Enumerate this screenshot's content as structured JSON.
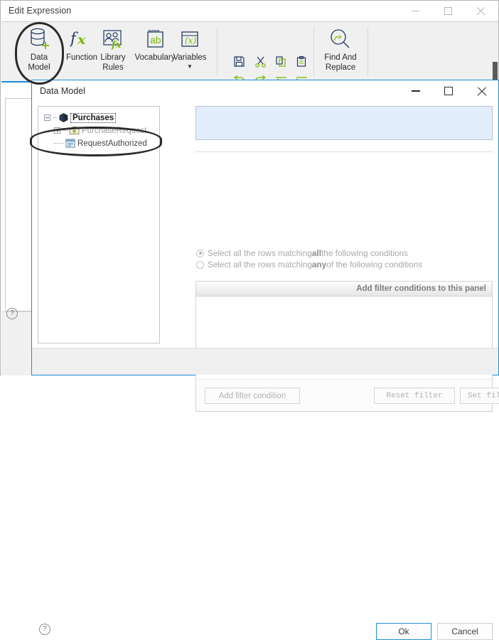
{
  "background_window": {
    "title": "Edit Expression",
    "caption": {
      "minimize": "minimize-icon",
      "maximize": "maximize-icon",
      "close": "close-icon"
    },
    "ribbon": {
      "items": [
        {
          "label_line1": "Data",
          "label_line2": "Model",
          "icon": "database-add-icon"
        },
        {
          "label_line1": "Function",
          "label_line2": "",
          "icon": "fx-icon"
        },
        {
          "label_line1": "Library",
          "label_line2": "Rules",
          "icon": "library-rules-icon"
        },
        {
          "label_line1": "Vocabulary",
          "label_line2": "",
          "icon": "vocabulary-ab-icon"
        },
        {
          "label_line1": "Variables",
          "label_line2": "",
          "icon": "variables-x-icon",
          "has_dropdown": true
        }
      ],
      "edit_tools": [
        {
          "name": "save-icon"
        },
        {
          "name": "cut-icon"
        },
        {
          "name": "copy-icon"
        },
        {
          "name": "paste-icon"
        },
        {
          "name": "undo-icon"
        },
        {
          "name": "redo-icon"
        },
        {
          "name": "outdent-icon"
        },
        {
          "name": "indent-icon"
        }
      ],
      "find_replace": {
        "label_line1": "Find And",
        "label_line2": "Replace",
        "icon": "find-replace-icon"
      }
    },
    "help_button": "?"
  },
  "dialog": {
    "title": "Data Model",
    "caption": {
      "minimize": "minimize-icon",
      "maximize": "maximize-icon",
      "close": "close-icon"
    },
    "tree": {
      "nodes": [
        {
          "label": "Purchases",
          "icon": "cube-icon",
          "expander": "minus",
          "selected": true,
          "disabled": false
        },
        {
          "label": "PurchaseRequest",
          "icon": "briefcase-icon",
          "expander": "plus",
          "selected": false,
          "disabled": true
        },
        {
          "label": "RequestAuthorized",
          "icon": "document-icon",
          "expander": "none",
          "selected": false,
          "disabled": false
        }
      ]
    },
    "filter_panel": {
      "radio_all": {
        "text_before": "Select all the rows matching ",
        "emphasis": "all",
        "text_after": " the following conditions",
        "selected": true
      },
      "radio_any": {
        "text_before": "Select all the rows matching ",
        "emphasis": "any",
        "text_after": " of the following conditions",
        "selected": false
      },
      "header_text": "Add filter conditions to this panel",
      "buttons": {
        "add_condition": "Add filter condition",
        "reset_filter": "Reset  filter",
        "set_filter": "Set  filter"
      }
    },
    "footer": {
      "help_button": "?",
      "ok": "Ok",
      "cancel": "Cancel"
    }
  },
  "annotations": [
    {
      "name": "data-model-highlight",
      "shape": "ellipse"
    },
    {
      "name": "request-authorized-highlight",
      "shape": "ellipse"
    }
  ],
  "colors": {
    "accent_blue": "#1b8dd6",
    "panel_gray": "#f0f0f0",
    "selection_blue": "#e2edfb",
    "icon_green": "#7ab800",
    "icon_navy": "#1f3864",
    "disabled_text": "#9b9b9b"
  }
}
